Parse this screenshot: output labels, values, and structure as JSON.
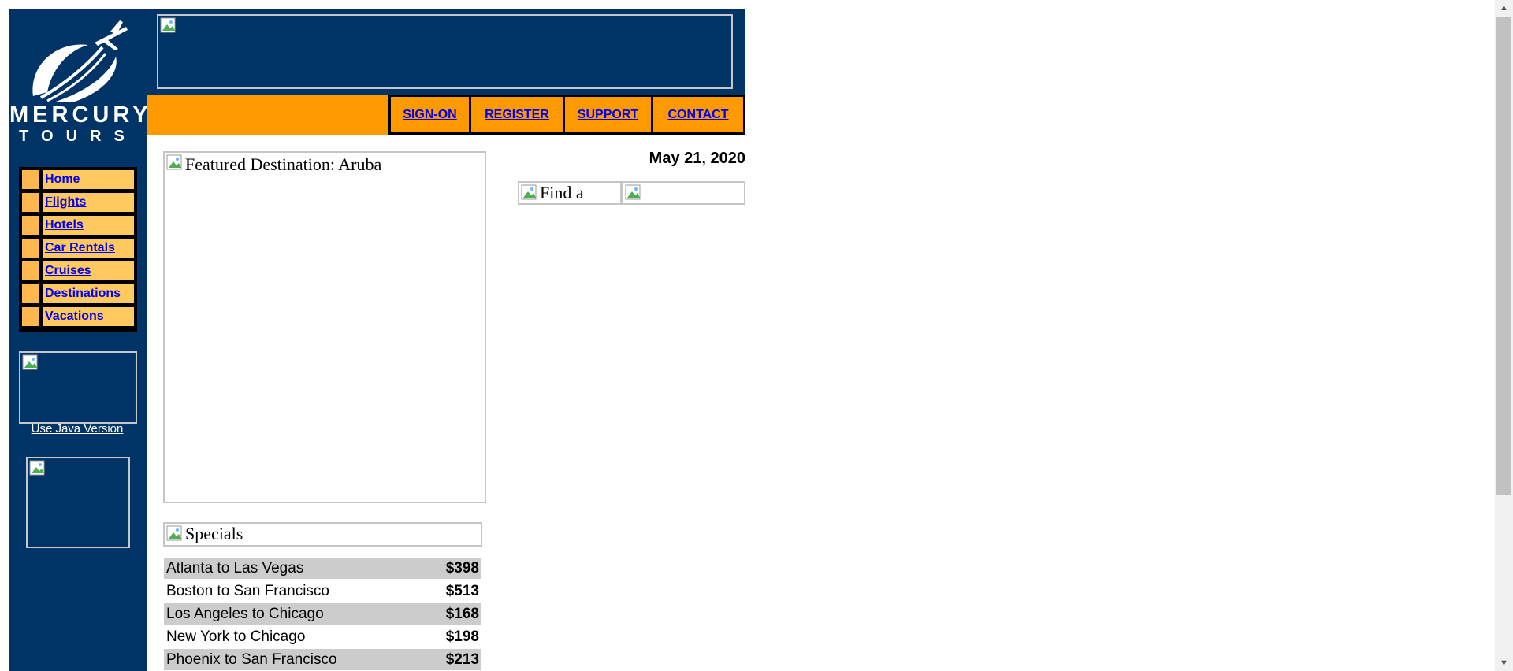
{
  "logo": {
    "line1": "MERCURY",
    "line2": "TOURS"
  },
  "nav": {
    "sign_on": "SIGN-ON",
    "register": "REGISTER",
    "support": "SUPPORT",
    "contact": "CONTACT"
  },
  "sidebar": {
    "items": [
      {
        "label": "Home"
      },
      {
        "label": "Flights"
      },
      {
        "label": "Hotels"
      },
      {
        "label": "Car Rentals"
      },
      {
        "label": "Cruises"
      },
      {
        "label": "Destinations"
      },
      {
        "label": "Vacations"
      }
    ],
    "java_link": "Use Java Version"
  },
  "date": "May 21, 2020",
  "featured": {
    "alt": "Featured Destination: Aruba"
  },
  "find_a": {
    "alt": "Find a"
  },
  "specials": {
    "alt": "Specials",
    "rows": [
      {
        "route": "Atlanta to Las Vegas",
        "price": "$398"
      },
      {
        "route": "Boston to San Francisco",
        "price": "$513"
      },
      {
        "route": "Los Angeles to Chicago",
        "price": "$168"
      },
      {
        "route": "New York to Chicago",
        "price": "$198"
      },
      {
        "route": "Phoenix to San Francisco",
        "price": "$213"
      }
    ]
  },
  "colors": {
    "navy": "#003366",
    "orange": "#ff9900",
    "menu_bg": "#ffc960",
    "link": "#0000ee"
  }
}
